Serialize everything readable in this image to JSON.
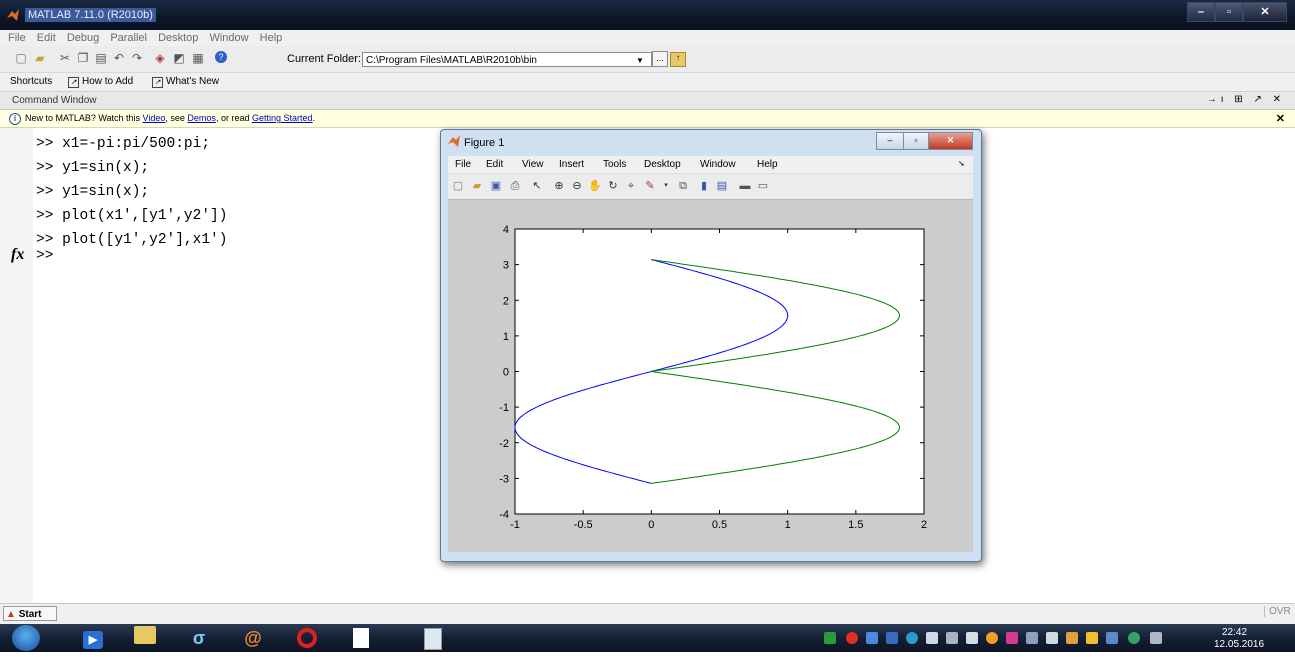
{
  "app": {
    "title": "MATLAB  7.11.0 (R2010b)"
  },
  "menubar": [
    "File",
    "Edit",
    "Debug",
    "Parallel",
    "Desktop",
    "Window",
    "Help"
  ],
  "toolbar": {
    "current_folder_label": "Current Folder:",
    "current_folder_value": "C:\\Program Files\\MATLAB\\R2010b\\bin",
    "browse_label": "..."
  },
  "shortcuts": {
    "label": "Shortcuts",
    "how_to_add": "How to Add",
    "whats_new": "What's New"
  },
  "command_window": {
    "title": "Command Window",
    "info_prefix": "New to MATLAB? Watch this ",
    "info_video": "Video",
    "info_mid1": ", see ",
    "info_demos": "Demos",
    "info_mid2": ", or read ",
    "info_getting_started": "Getting Started",
    "info_suffix": ".",
    "lines": [
      ">> x1=-pi:pi/500:pi;",
      ">> y1=sin(x);",
      ">> y1=sin(x);",
      ">> plot(x1',[y1',y2'])",
      ">> plot([y1',y2'],x1')"
    ],
    "prompt": ">>",
    "fx": "fx"
  },
  "statusbar": {
    "start": "Start",
    "ovr": "OVR"
  },
  "figure": {
    "title": "Figure 1",
    "menu": [
      "File",
      "Edit",
      "View",
      "Insert",
      "Tools",
      "Desktop",
      "Window",
      "Help"
    ]
  },
  "chart_data": {
    "type": "line",
    "title": "",
    "xlabel": "",
    "ylabel": "",
    "xlim": [
      -1,
      2
    ],
    "ylim": [
      -4,
      4
    ],
    "xticks": [
      "-1",
      "-0.5",
      "0",
      "0.5",
      "1",
      "1.5",
      "2"
    ],
    "yticks": [
      "-4",
      "-3",
      "-2",
      "-1",
      "0",
      "1",
      "2",
      "3",
      "4"
    ],
    "series": [
      {
        "color": "#0000ff",
        "description": "x = sin(t), y = t for t in [-pi, pi]",
        "x": [
          0,
          -0.588,
          -0.951,
          -0.951,
          -0.588,
          0,
          0.588,
          0.951,
          0.951,
          0.588,
          0
        ],
        "y": [
          -3.1416,
          -2.5133,
          -1.885,
          -1.2566,
          -0.6283,
          0,
          0.6283,
          1.2566,
          1.885,
          2.5133,
          3.1416
        ]
      },
      {
        "color": "#008000",
        "description": "second column: x = y2, y = t",
        "x": [
          0,
          0.7,
          1.55,
          1.82,
          1.4,
          0,
          0.6,
          1.5,
          1.82,
          1.2,
          0
        ],
        "y": [
          -3.1416,
          -2.8,
          -2.3,
          -2.0,
          -1.4,
          0,
          1.0,
          1.6,
          2.0,
          2.6,
          3.1416
        ]
      }
    ],
    "grid": false
  },
  "taskbar": {
    "time": "22:42",
    "date": "12.05.2016"
  }
}
